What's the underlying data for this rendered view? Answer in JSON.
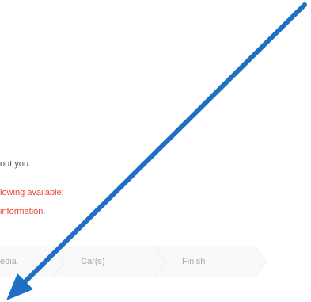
{
  "form": {
    "intro_text": "out you.",
    "notice_line_1": "lowing available:",
    "notice_line_2": " information."
  },
  "wizard": {
    "steps": [
      {
        "label": "edia"
      },
      {
        "label": "Car(s)"
      },
      {
        "label": "Finish"
      }
    ]
  },
  "colors": {
    "notice_text": "#e84a3a",
    "step_text": "#a8a8a8",
    "step_background": "#f9f9f9",
    "annotation_arrow": "#1f6fc4"
  }
}
